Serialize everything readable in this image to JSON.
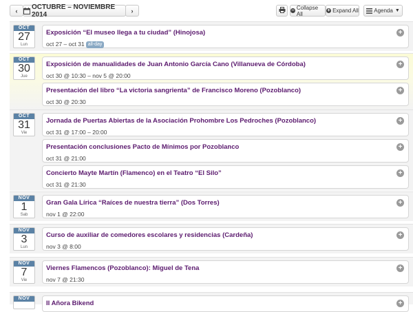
{
  "toolbar": {
    "prev_icon": "chevron-left-icon",
    "next_icon": "chevron-right-icon",
    "range_title": "OCTUBRE – NOVIEMBRE 2014",
    "print_icon": "print-icon",
    "collapse_label": "Collapse All",
    "expand_label": "Expand All",
    "view_label": "Agenda"
  },
  "colors": {
    "month_band": "#5b82a5",
    "event_title": "#5b1a6e",
    "today_bg": "#fbfbd6",
    "badge": "#8aa9c4"
  },
  "days": [
    {
      "month": "OCT",
      "day": "27",
      "weekday": "Lun",
      "today": false,
      "events": [
        {
          "title": "Exposición “El museo llega a tu ciudad” (Hinojosa)",
          "time": "oct 27 – oct 31",
          "badge": "all-day"
        }
      ]
    },
    {
      "month": "OCT",
      "day": "30",
      "weekday": "Jue",
      "today": true,
      "events": [
        {
          "title": "Exposición de manualidades de Juan Antonio García Cano (Villanueva de Córdoba)",
          "time": "oct 30 @ 10:30 – nov 5 @ 20:00"
        },
        {
          "title": "Presentación del libro “La victoria sangrienta” de Francisco Moreno (Pozoblanco)",
          "time": "oct 30 @ 20:30"
        }
      ]
    },
    {
      "month": "OCT",
      "day": "31",
      "weekday": "Vie",
      "today": false,
      "events": [
        {
          "title": "Jornada de Puertas Abiertas de la Asociación Prohombre Los Pedroches (Pozoblanco)",
          "time": "oct 31 @ 17:00 – 20:00"
        },
        {
          "title": "Presentación conclusiones Pacto de Mínimos por Pozoblanco",
          "time": "oct 31 @ 21:00"
        },
        {
          "title": "Concierto Mayte Martín (Flamenco) en el Teatro “El Silo”",
          "time": "oct 31 @ 21:30"
        }
      ]
    },
    {
      "month": "NOV",
      "day": "1",
      "weekday": "Sab",
      "today": false,
      "events": [
        {
          "title": "Gran Gala Lírica “Raíces de nuestra tierra” (Dos Torres)",
          "time": "nov 1 @ 22:00"
        }
      ]
    },
    {
      "month": "NOV",
      "day": "3",
      "weekday": "Lun",
      "today": false,
      "events": [
        {
          "title": "Curso de auxiliar de comedores escolares y residencias (Cardeña)",
          "time": "nov 3 @ 8:00"
        }
      ]
    },
    {
      "month": "NOV",
      "day": "7",
      "weekday": "Vie",
      "today": false,
      "events": [
        {
          "title": "Viernes Flamencos (Pozoblanco): Miguel de Tena",
          "time": "nov 7 @ 21:30"
        }
      ]
    },
    {
      "month": "NOV",
      "day": "",
      "weekday": "",
      "today": false,
      "events": [
        {
          "title": "II Añora Bikend",
          "time": ""
        }
      ]
    }
  ]
}
